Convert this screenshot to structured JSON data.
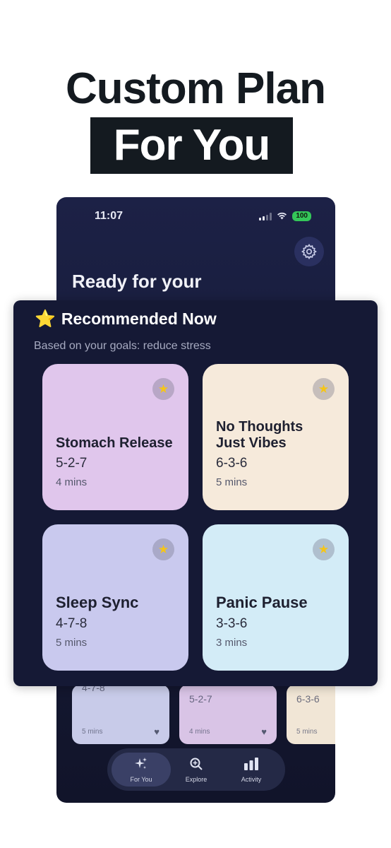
{
  "headline": {
    "line1": "Custom Plan",
    "line2": "For You"
  },
  "status_bar": {
    "time": "11:07",
    "battery": "100"
  },
  "home": {
    "greeting": "Ready for your"
  },
  "background_cards": [
    {
      "pattern": "4-7-8",
      "duration": "5 mins",
      "color": "#c8cbe9"
    },
    {
      "pattern": "5-2-7",
      "duration": "4 mins",
      "color": "#d9c4e6"
    },
    {
      "pattern": "6-3-6",
      "duration": "5 mins",
      "color": "#f1e6d6"
    }
  ],
  "tabs": [
    {
      "label": "For You",
      "icon": "sparkles-icon",
      "active": true
    },
    {
      "label": "Explore",
      "icon": "zoom-icon"
    },
    {
      "label": "Activity",
      "icon": "bar-chart-icon"
    }
  ],
  "recommended": {
    "emoji": "⭐",
    "title": "Recommended Now",
    "subtitle": "Based on your goals: reduce stress",
    "cards": [
      {
        "name": "Stomach Release",
        "pattern": "5-2-7",
        "duration": "4 mins",
        "color": "#e0c6ec"
      },
      {
        "name": "No Thoughts Just Vibes",
        "name_line1": "No Thoughts",
        "name_line2": "Just Vibes",
        "pattern": "6-3-6",
        "duration": "5 mins",
        "color": "#f6eadb"
      },
      {
        "name": "Sleep Sync",
        "pattern": "4-7-8",
        "duration": "5 mins",
        "color": "#c9c9ee"
      },
      {
        "name": "Panic Pause",
        "pattern": "3-3-6",
        "duration": "3 mins",
        "color": "#d3ecf7"
      }
    ]
  }
}
